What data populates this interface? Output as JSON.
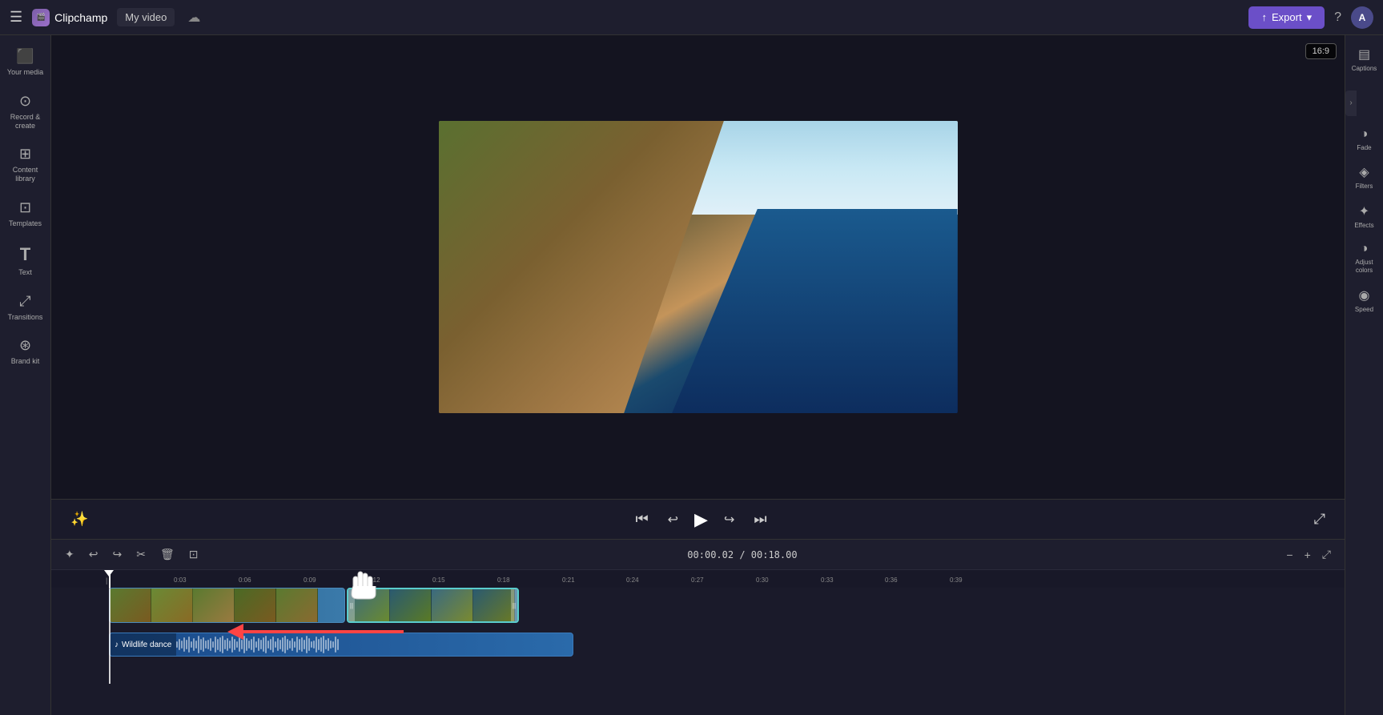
{
  "app": {
    "name": "Clipchamp",
    "logo_icon": "🎬",
    "title": "My video",
    "cloud_status": "☁"
  },
  "topbar": {
    "export_label": "Export",
    "help_label": "?",
    "avatar_label": "A"
  },
  "left_sidebar": {
    "items": [
      {
        "id": "your-media",
        "icon": "▦",
        "label": "Your media"
      },
      {
        "id": "record-create",
        "icon": "⊙",
        "label": "Record &\ncreate"
      },
      {
        "id": "content-library",
        "icon": "⊞",
        "label": "Content\nlibrary"
      },
      {
        "id": "templates",
        "icon": "⊡",
        "label": "Templates"
      },
      {
        "id": "text",
        "icon": "T",
        "label": "Text"
      },
      {
        "id": "transitions",
        "icon": "⤢",
        "label": "Transitions"
      },
      {
        "id": "brand-kit",
        "icon": "⊛",
        "label": "Brand kit"
      }
    ]
  },
  "right_sidebar": {
    "items": [
      {
        "id": "captions",
        "icon": "≡",
        "label": "Captions"
      },
      {
        "id": "fade",
        "icon": "◑",
        "label": "Fade"
      },
      {
        "id": "filters",
        "icon": "◈",
        "label": "Filters"
      },
      {
        "id": "effects",
        "icon": "✦",
        "label": "Effects"
      },
      {
        "id": "adjust-colors",
        "icon": "◑",
        "label": "Adjust\ncolors"
      },
      {
        "id": "speed",
        "icon": "◉",
        "label": "Speed"
      }
    ]
  },
  "preview": {
    "aspect_ratio": "16:9"
  },
  "timeline": {
    "current_time": "00:00.02",
    "total_time": "00:18.00",
    "ruler_marks": [
      "0:03",
      "0:06",
      "0:09",
      "0:12",
      "0:15",
      "0:18",
      "0:21",
      "0:24",
      "0:27",
      "0:30",
      "0:33",
      "0:36",
      "0:39"
    ]
  },
  "audio_track": {
    "icon": "♪",
    "name": "Wildlife dance"
  }
}
